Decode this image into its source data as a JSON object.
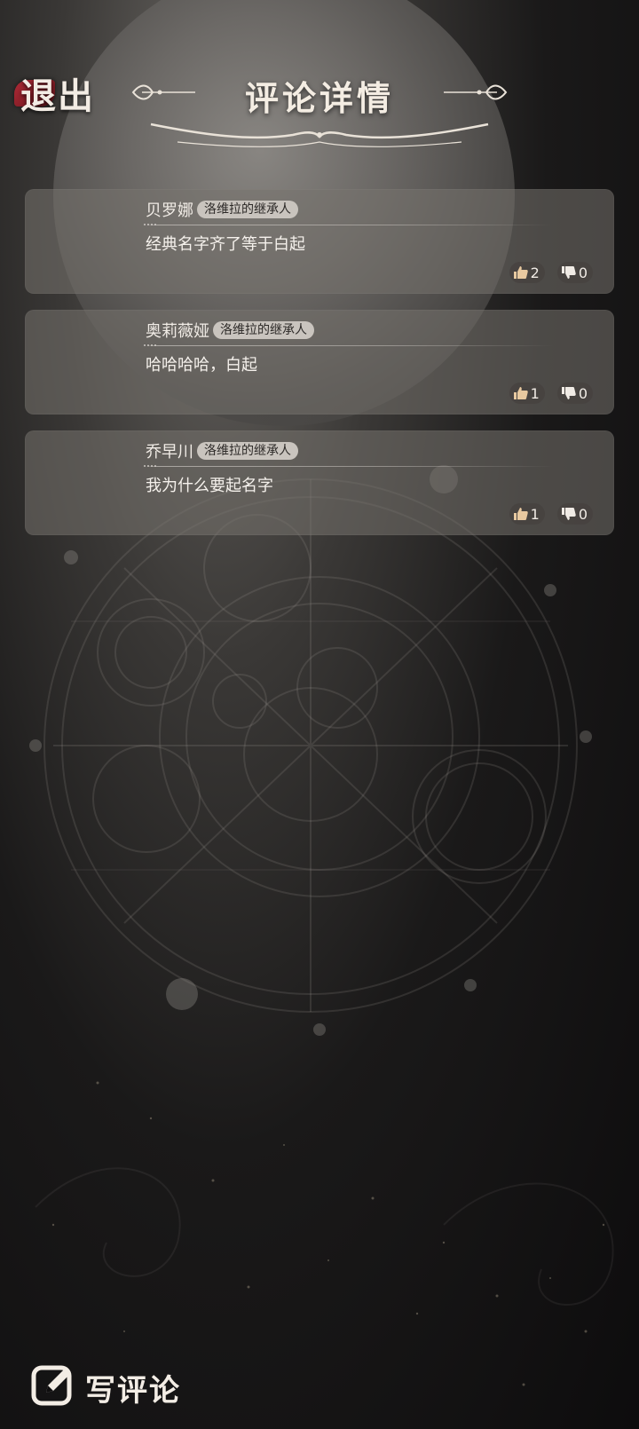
{
  "header": {
    "exit_label": "退出",
    "title": "评论详情"
  },
  "comments": [
    {
      "username": "贝罗娜",
      "title_tag": "洛维拉的继承人",
      "text": "经典名字齐了等于白起",
      "likes": "2",
      "dislikes": "0"
    },
    {
      "username": "奥莉薇娅",
      "title_tag": "洛维拉的继承人",
      "text": "哈哈哈哈，白起",
      "likes": "1",
      "dislikes": "0"
    },
    {
      "username": "乔早川",
      "title_tag": "洛维拉的继承人",
      "text": "我为什么要起名字",
      "likes": "1",
      "dislikes": "0"
    }
  ],
  "footer": {
    "write_comment_label": "写评论"
  },
  "icons": {
    "like": "thumbs-up-icon",
    "dislike": "thumbs-down-icon",
    "write": "edit-icon"
  },
  "colors": {
    "card_bg": "#76726e",
    "tag_bg": "#c9c4be",
    "exit_badge": "#b02a36",
    "like_icon": "#e8c9a0"
  }
}
